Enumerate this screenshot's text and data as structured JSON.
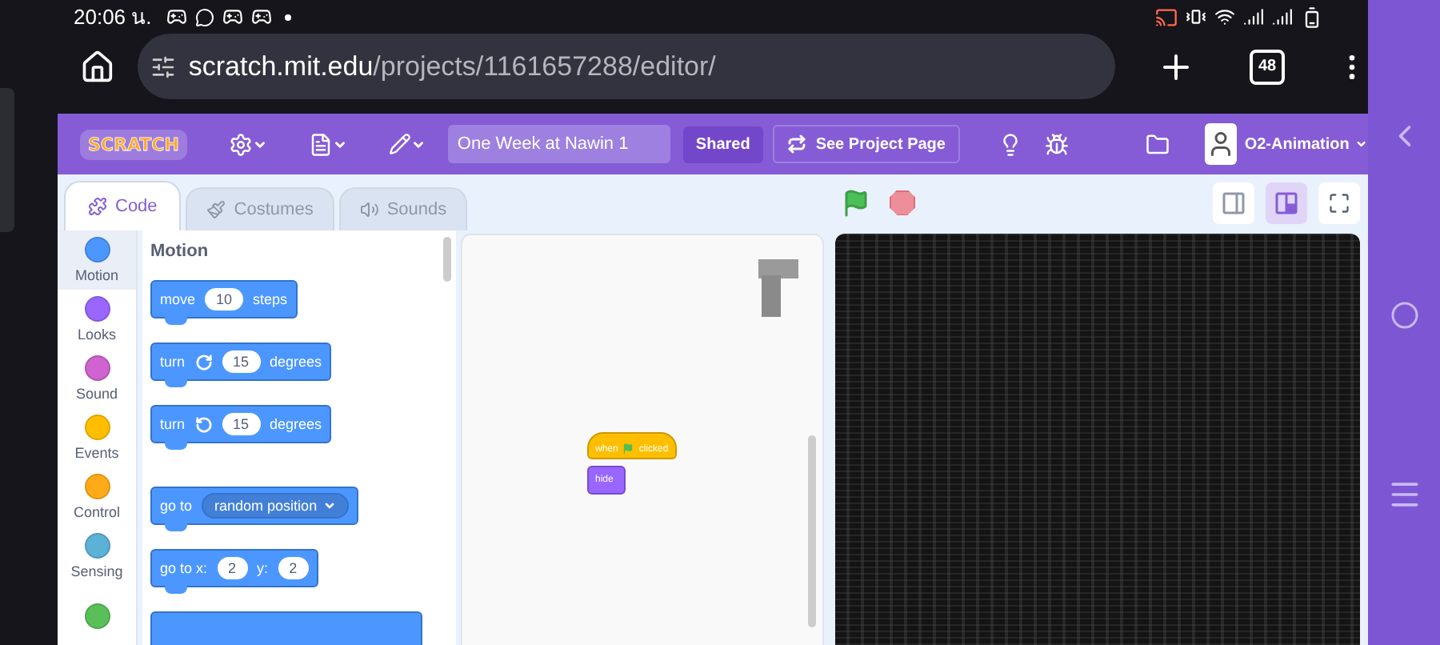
{
  "status_bar": {
    "time": "20:06 น."
  },
  "browser": {
    "url_host": "scratch.mit.edu",
    "url_path": "/projects/1161657288/editor/",
    "tab_count": "48"
  },
  "menubar": {
    "logo": "SCRATCH",
    "project_title": "One Week at Nawin 1",
    "shared": "Shared",
    "see_project_page": "See Project Page",
    "username": "O2-Animation"
  },
  "tabs": [
    {
      "label": "Code",
      "selected": true
    },
    {
      "label": "Costumes",
      "selected": false
    },
    {
      "label": "Sounds",
      "selected": false
    }
  ],
  "categories": [
    {
      "label": "Motion",
      "color": "#4c97ff",
      "selected": true
    },
    {
      "label": "Looks",
      "color": "#9966ff",
      "selected": false
    },
    {
      "label": "Sound",
      "color": "#cf63cf",
      "selected": false
    },
    {
      "label": "Events",
      "color": "#ffbf00",
      "selected": false
    },
    {
      "label": "Control",
      "color": "#ffab19",
      "selected": false
    },
    {
      "label": "Sensing",
      "color": "#5cb1d6",
      "selected": false
    },
    {
      "color": "#59c059",
      "selected": false
    }
  ],
  "palette": {
    "heading": "Motion",
    "blocks": [
      {
        "parts": [
          {
            "kind": "text",
            "text": "move"
          },
          {
            "kind": "input",
            "text": "10"
          },
          {
            "kind": "text",
            "text": "steps"
          }
        ]
      },
      {
        "parts": [
          {
            "kind": "text",
            "text": "turn"
          },
          {
            "kind": "cw"
          },
          {
            "kind": "input",
            "text": "15"
          },
          {
            "kind": "text",
            "text": "degrees"
          }
        ]
      },
      {
        "parts": [
          {
            "kind": "text",
            "text": "turn"
          },
          {
            "kind": "ccw"
          },
          {
            "kind": "input",
            "text": "15"
          },
          {
            "kind": "text",
            "text": "degrees"
          }
        ]
      },
      {
        "parts": [
          {
            "kind": "text",
            "text": "go to"
          },
          {
            "kind": "dropdown",
            "text": "random position"
          }
        ]
      },
      {
        "parts": [
          {
            "kind": "text",
            "text": "go to x:"
          },
          {
            "kind": "input",
            "text": "2"
          },
          {
            "kind": "text",
            "text": "y:"
          },
          {
            "kind": "input",
            "text": "2"
          }
        ]
      },
      {
        "kind": "cut"
      }
    ]
  },
  "script": {
    "hat": {
      "before": "when",
      "after": "clicked"
    },
    "stack": "hide"
  },
  "stage_modes": [
    {
      "selected": false
    },
    {
      "selected": true
    }
  ]
}
